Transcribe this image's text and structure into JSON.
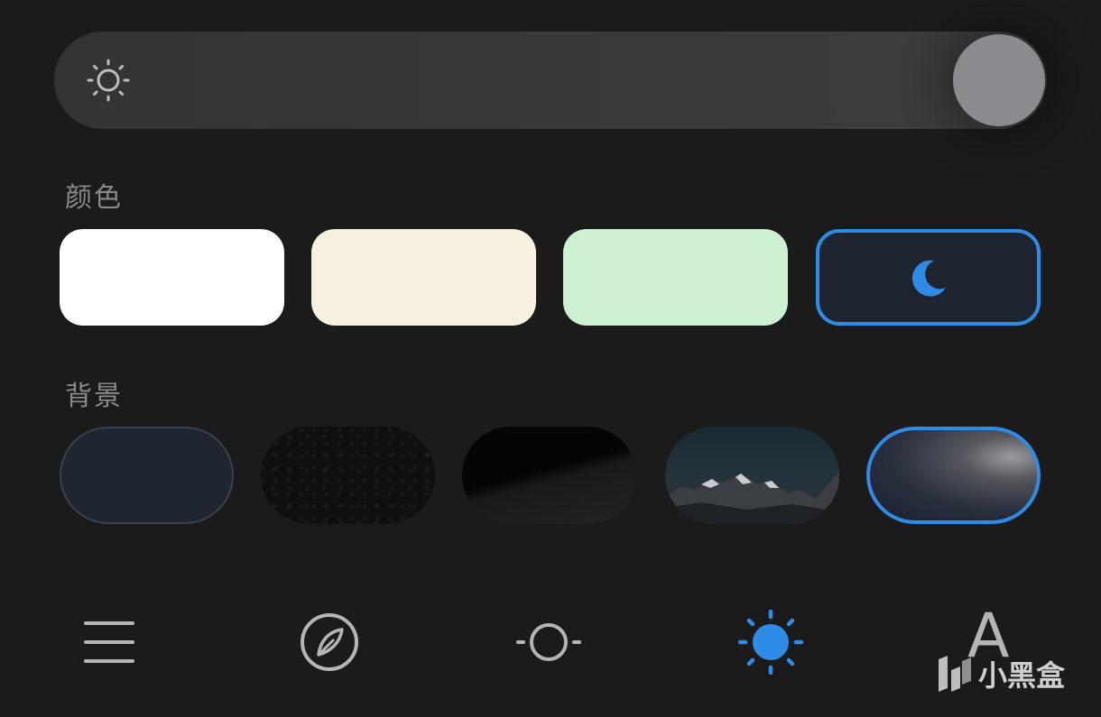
{
  "brightness": {
    "icon": "sun-outline-icon",
    "level": 1.0
  },
  "colors_section": {
    "label": "颜色",
    "swatches": [
      {
        "color": "#ffffff"
      },
      {
        "color": "#f6f0df"
      },
      {
        "color": "#cdf0d1"
      },
      {
        "color": "#1e2430",
        "icon": "moon-icon",
        "selected": true
      }
    ]
  },
  "background_section": {
    "label": "背景",
    "items": [
      {
        "name": "solid-dark-navy"
      },
      {
        "name": "black-texture"
      },
      {
        "name": "dark-dune"
      },
      {
        "name": "mountain-night"
      },
      {
        "name": "night-clouds",
        "selected": true
      }
    ]
  },
  "bottom_nav": {
    "items": [
      {
        "icon": "menu-icon"
      },
      {
        "icon": "compass-icon"
      },
      {
        "icon": "circle-indicator-icon"
      },
      {
        "icon": "sun-filled-icon",
        "active": true
      },
      {
        "icon": "font-icon",
        "label": "A"
      }
    ]
  },
  "watermark": {
    "text": "小黑盒"
  },
  "accent_color": "#2e8be6"
}
